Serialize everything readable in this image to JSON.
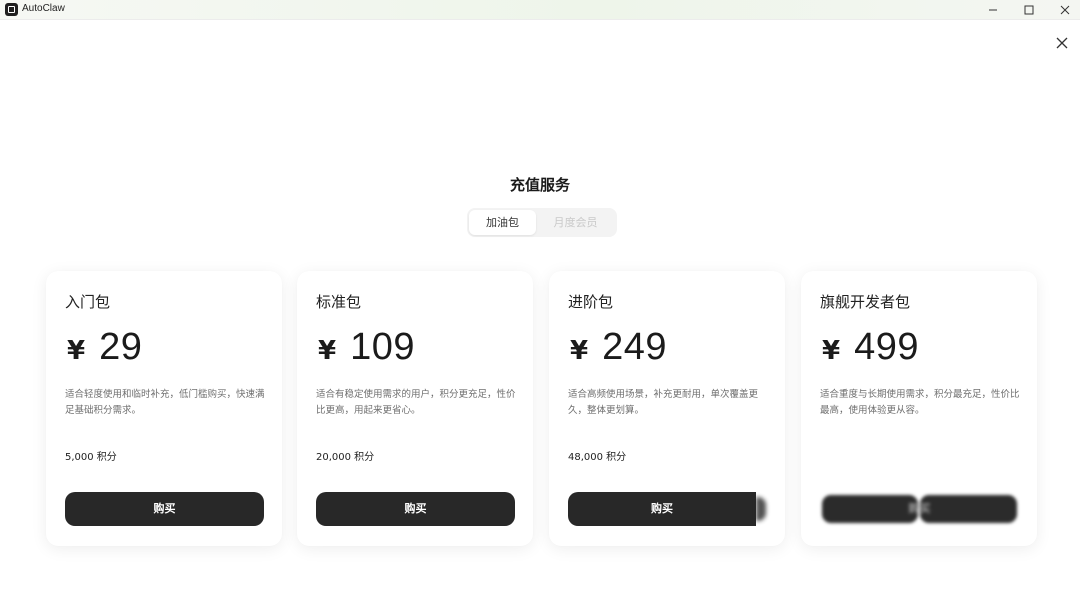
{
  "window": {
    "title": "AutoClaw"
  },
  "page": {
    "heading": "充值服务"
  },
  "tabs": [
    {
      "label": "加油包",
      "active": true
    },
    {
      "label": "月度会员",
      "active": false
    }
  ],
  "plans": [
    {
      "title": "入门包",
      "currency": "¥",
      "price": "29",
      "description": "适合轻度使用和临时补充，低门槛购买，快速满足基础积分需求。",
      "credits": "5,000 积分",
      "button": "购买"
    },
    {
      "title": "标准包",
      "currency": "¥",
      "price": "109",
      "description": "适合有稳定使用需求的用户，积分更充足，性价比更高，用起来更省心。",
      "credits": "20,000 积分",
      "button": "购买"
    },
    {
      "title": "进阶包",
      "currency": "¥",
      "price": "249",
      "description": "适合高频使用场景，补充更耐用，单次覆盖更久，整体更划算。",
      "credits": "48,000 积分",
      "button": "购买"
    },
    {
      "title": "旗舰开发者包",
      "currency": "¥",
      "price": "499",
      "description": "适合重度与长期使用需求，积分最充足，性价比最高，使用体验更从容。",
      "credits": "",
      "button": "购买"
    }
  ]
}
